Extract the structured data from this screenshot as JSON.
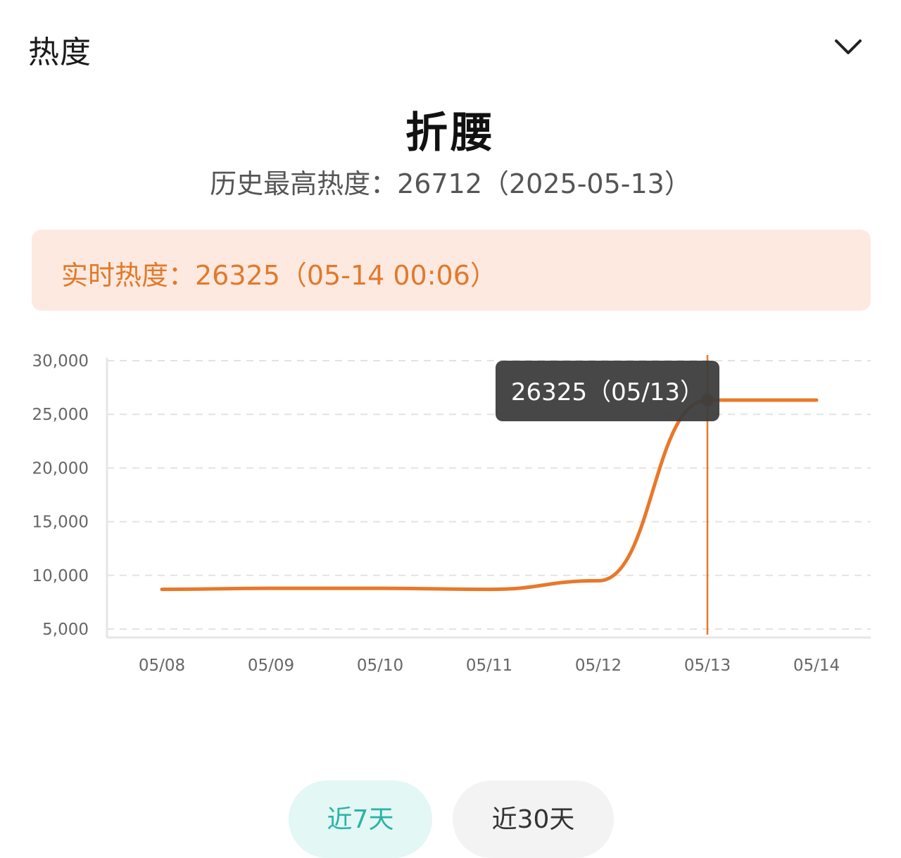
{
  "header": {
    "title": "热度",
    "collapse_icon": "chevron-down-icon"
  },
  "topic": {
    "title": "折腰",
    "peak_label": "历史最高热度：26712（2025-05-13）"
  },
  "realtime": {
    "label": "实时热度：26325（05-14 00:06）"
  },
  "tooltip": {
    "text": "26325（05/13）"
  },
  "range_tabs": {
    "active": "近7天",
    "items": [
      "近7天",
      "近30天"
    ]
  },
  "colors": {
    "line": "#e8782a",
    "realtime_bg": "#fde9e0",
    "realtime_text": "#e07a2c",
    "tooltip_bg": "#3d3d3d",
    "active_tab_bg": "#e3f7f5",
    "active_tab_text": "#2bb3a6"
  },
  "chart_data": {
    "type": "line",
    "x": [
      "05/08",
      "05/09",
      "05/10",
      "05/11",
      "05/12",
      "05/13",
      "05/14"
    ],
    "y_ticks": [
      "30,000",
      "25,000",
      "20,000",
      "15,000",
      "10,000",
      "5,000"
    ],
    "ylim": [
      5000,
      30000
    ],
    "series": [
      {
        "values": [
          8700,
          8800,
          8800,
          8700,
          9500,
          26325,
          26325
        ]
      }
    ],
    "highlighted_index": 5,
    "grid": true,
    "smooth": true
  }
}
